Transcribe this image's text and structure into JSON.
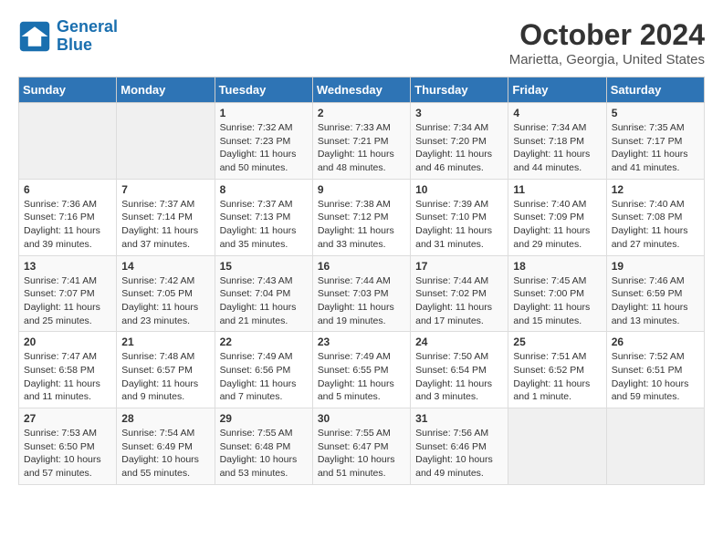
{
  "header": {
    "logo_line1": "General",
    "logo_line2": "Blue",
    "title": "October 2024",
    "subtitle": "Marietta, Georgia, United States"
  },
  "weekdays": [
    "Sunday",
    "Monday",
    "Tuesday",
    "Wednesday",
    "Thursday",
    "Friday",
    "Saturday"
  ],
  "weeks": [
    [
      {
        "day": "",
        "empty": true
      },
      {
        "day": "",
        "empty": true
      },
      {
        "day": "1",
        "sunrise": "7:32 AM",
        "sunset": "7:23 PM",
        "daylight": "11 hours and 50 minutes."
      },
      {
        "day": "2",
        "sunrise": "7:33 AM",
        "sunset": "7:21 PM",
        "daylight": "11 hours and 48 minutes."
      },
      {
        "day": "3",
        "sunrise": "7:34 AM",
        "sunset": "7:20 PM",
        "daylight": "11 hours and 46 minutes."
      },
      {
        "day": "4",
        "sunrise": "7:34 AM",
        "sunset": "7:18 PM",
        "daylight": "11 hours and 44 minutes."
      },
      {
        "day": "5",
        "sunrise": "7:35 AM",
        "sunset": "7:17 PM",
        "daylight": "11 hours and 41 minutes."
      }
    ],
    [
      {
        "day": "6",
        "sunrise": "7:36 AM",
        "sunset": "7:16 PM",
        "daylight": "11 hours and 39 minutes."
      },
      {
        "day": "7",
        "sunrise": "7:37 AM",
        "sunset": "7:14 PM",
        "daylight": "11 hours and 37 minutes."
      },
      {
        "day": "8",
        "sunrise": "7:37 AM",
        "sunset": "7:13 PM",
        "daylight": "11 hours and 35 minutes."
      },
      {
        "day": "9",
        "sunrise": "7:38 AM",
        "sunset": "7:12 PM",
        "daylight": "11 hours and 33 minutes."
      },
      {
        "day": "10",
        "sunrise": "7:39 AM",
        "sunset": "7:10 PM",
        "daylight": "11 hours and 31 minutes."
      },
      {
        "day": "11",
        "sunrise": "7:40 AM",
        "sunset": "7:09 PM",
        "daylight": "11 hours and 29 minutes."
      },
      {
        "day": "12",
        "sunrise": "7:40 AM",
        "sunset": "7:08 PM",
        "daylight": "11 hours and 27 minutes."
      }
    ],
    [
      {
        "day": "13",
        "sunrise": "7:41 AM",
        "sunset": "7:07 PM",
        "daylight": "11 hours and 25 minutes."
      },
      {
        "day": "14",
        "sunrise": "7:42 AM",
        "sunset": "7:05 PM",
        "daylight": "11 hours and 23 minutes."
      },
      {
        "day": "15",
        "sunrise": "7:43 AM",
        "sunset": "7:04 PM",
        "daylight": "11 hours and 21 minutes."
      },
      {
        "day": "16",
        "sunrise": "7:44 AM",
        "sunset": "7:03 PM",
        "daylight": "11 hours and 19 minutes."
      },
      {
        "day": "17",
        "sunrise": "7:44 AM",
        "sunset": "7:02 PM",
        "daylight": "11 hours and 17 minutes."
      },
      {
        "day": "18",
        "sunrise": "7:45 AM",
        "sunset": "7:00 PM",
        "daylight": "11 hours and 15 minutes."
      },
      {
        "day": "19",
        "sunrise": "7:46 AM",
        "sunset": "6:59 PM",
        "daylight": "11 hours and 13 minutes."
      }
    ],
    [
      {
        "day": "20",
        "sunrise": "7:47 AM",
        "sunset": "6:58 PM",
        "daylight": "11 hours and 11 minutes."
      },
      {
        "day": "21",
        "sunrise": "7:48 AM",
        "sunset": "6:57 PM",
        "daylight": "11 hours and 9 minutes."
      },
      {
        "day": "22",
        "sunrise": "7:49 AM",
        "sunset": "6:56 PM",
        "daylight": "11 hours and 7 minutes."
      },
      {
        "day": "23",
        "sunrise": "7:49 AM",
        "sunset": "6:55 PM",
        "daylight": "11 hours and 5 minutes."
      },
      {
        "day": "24",
        "sunrise": "7:50 AM",
        "sunset": "6:54 PM",
        "daylight": "11 hours and 3 minutes."
      },
      {
        "day": "25",
        "sunrise": "7:51 AM",
        "sunset": "6:52 PM",
        "daylight": "11 hours and 1 minute."
      },
      {
        "day": "26",
        "sunrise": "7:52 AM",
        "sunset": "6:51 PM",
        "daylight": "10 hours and 59 minutes."
      }
    ],
    [
      {
        "day": "27",
        "sunrise": "7:53 AM",
        "sunset": "6:50 PM",
        "daylight": "10 hours and 57 minutes."
      },
      {
        "day": "28",
        "sunrise": "7:54 AM",
        "sunset": "6:49 PM",
        "daylight": "10 hours and 55 minutes."
      },
      {
        "day": "29",
        "sunrise": "7:55 AM",
        "sunset": "6:48 PM",
        "daylight": "10 hours and 53 minutes."
      },
      {
        "day": "30",
        "sunrise": "7:55 AM",
        "sunset": "6:47 PM",
        "daylight": "10 hours and 51 minutes."
      },
      {
        "day": "31",
        "sunrise": "7:56 AM",
        "sunset": "6:46 PM",
        "daylight": "10 hours and 49 minutes."
      },
      {
        "day": "",
        "empty": true
      },
      {
        "day": "",
        "empty": true
      }
    ]
  ]
}
